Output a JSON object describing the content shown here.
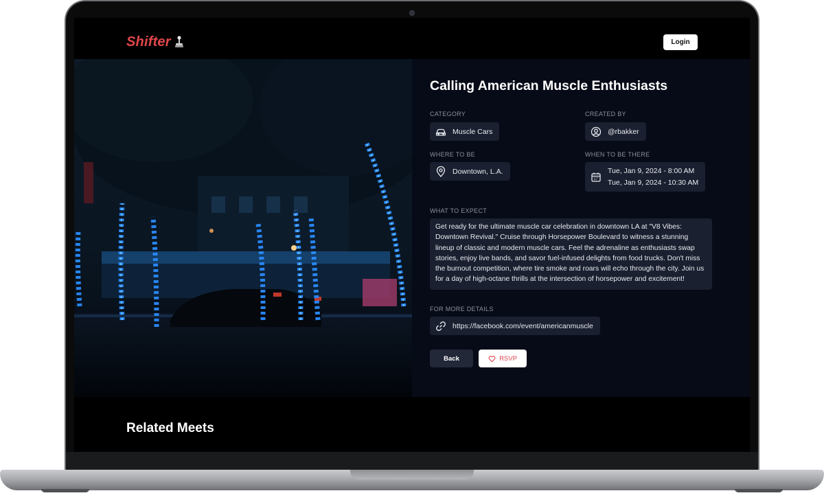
{
  "app": {
    "name": "Shifter",
    "login_label": "Login"
  },
  "event": {
    "title": "Calling American Muscle Enthusiasts",
    "category_label": "CATEGORY",
    "category_value": "Muscle Cars",
    "created_by_label": "CREATED BY",
    "created_by_value": "@rbakker",
    "where_label": "WHERE TO BE",
    "where_value": "Downtown, L.A.",
    "when_label": "WHEN TO BE THERE",
    "when_start": "Tue, Jan 9, 2024 - 8:00 AM",
    "when_end": "Tue, Jan 9, 2024 - 10:30 AM",
    "expect_label": "WHAT TO EXPECT",
    "description": "Get ready for the ultimate muscle car celebration in downtown LA at \"V8 Vibes: Downtown Revival.\" Cruise through Horsepower Boulevard to witness a stunning lineup of classic and modern muscle cars. Feel the adrenaline as enthusiasts swap stories, enjoy live bands, and savor fuel-infused delights from food trucks. Don't miss the burnout competition, where tire smoke and roars will echo through the city. Join us for a day of high-octane thrills at the intersection of horsepower and excitement!",
    "details_label": "FOR MORE DETAILS",
    "details_link": "https://facebook.com/event/americanmuscle",
    "back_label": "Back",
    "rsvp_label": "RSVP"
  },
  "related": {
    "heading": "Related Meets"
  },
  "icons": {
    "logo": "gear-shifter-icon",
    "category": "car-icon",
    "created_by": "user-circle-icon",
    "where": "map-pin-icon",
    "when": "calendar-icon",
    "details": "link-icon",
    "rsvp": "heart-icon"
  },
  "colors": {
    "brand": "#e0474b",
    "panel_bg": "#070b18",
    "chip_bg": "#1b2030",
    "rsvp_text": "#d8434a"
  }
}
